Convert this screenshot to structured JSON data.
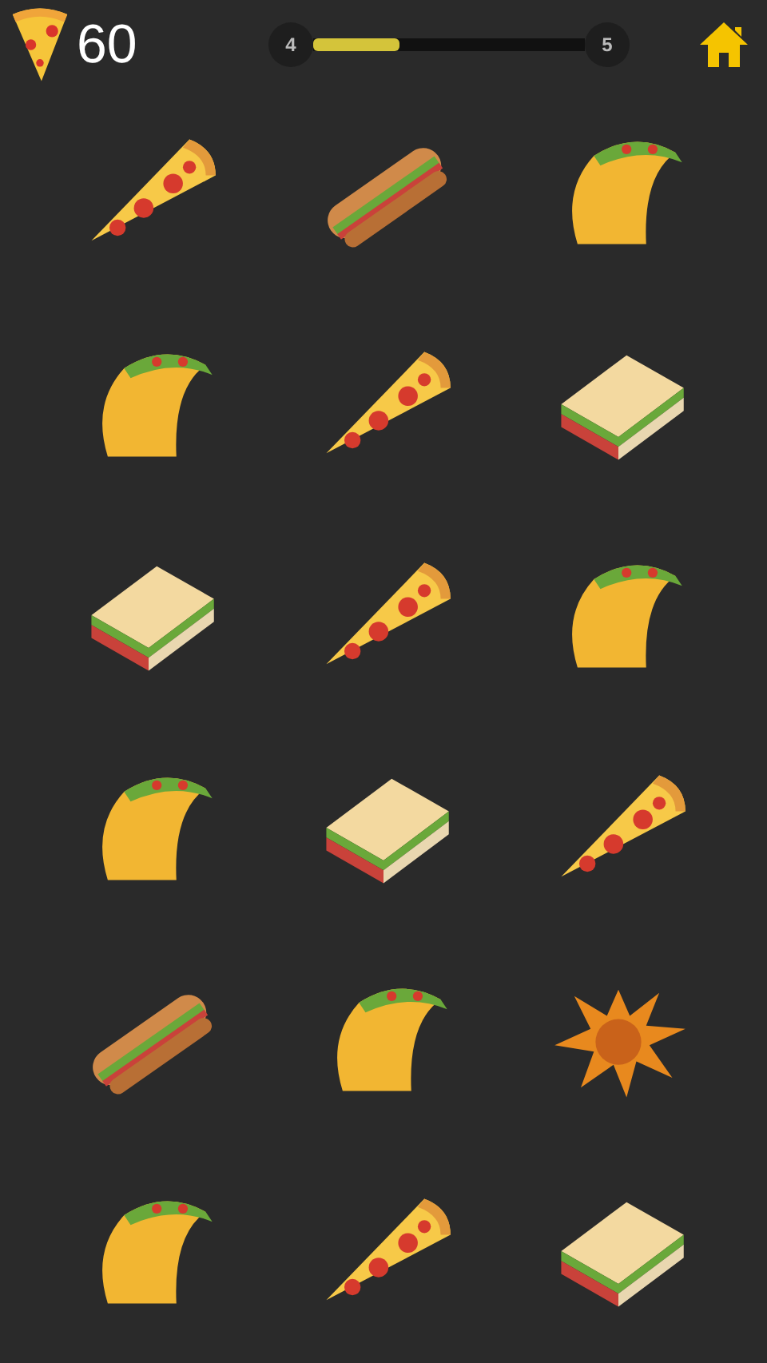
{
  "header": {
    "score": "60",
    "progress": {
      "from_level": "4",
      "to_level": "5",
      "level": 0.32
    }
  },
  "grid": [
    {
      "kind": "pizza"
    },
    {
      "kind": "sub"
    },
    {
      "kind": "taco"
    },
    {
      "kind": "taco"
    },
    {
      "kind": "pizza"
    },
    {
      "kind": "sandwich"
    },
    {
      "kind": "sandwich"
    },
    {
      "kind": "pizza"
    },
    {
      "kind": "taco"
    },
    {
      "kind": "taco"
    },
    {
      "kind": "sandwich"
    },
    {
      "kind": "pizza"
    },
    {
      "kind": "sub"
    },
    {
      "kind": "taco"
    },
    {
      "kind": "splat"
    },
    {
      "kind": "taco"
    },
    {
      "kind": "pizza"
    },
    {
      "kind": "sandwich"
    }
  ]
}
